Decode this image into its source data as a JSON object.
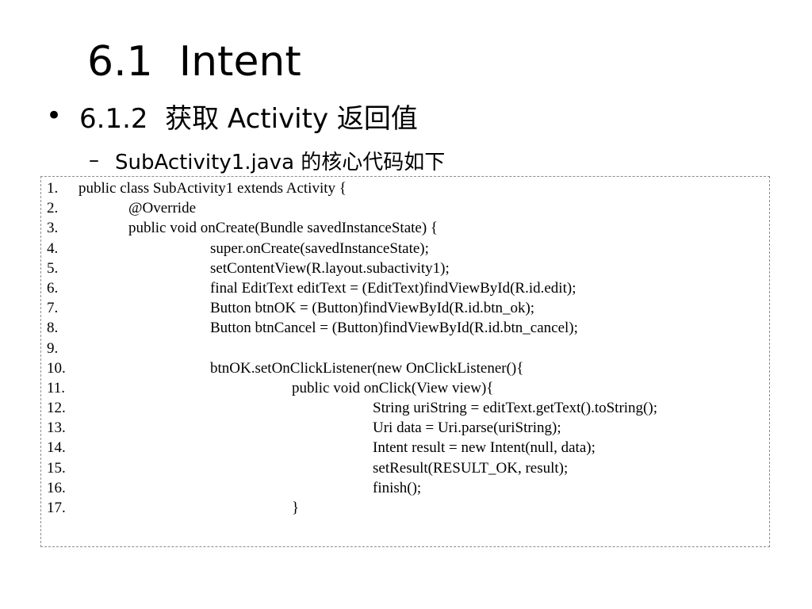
{
  "slide": {
    "title": "6.1  Intent",
    "bullet1": {
      "marker": "•",
      "text": "6.1.2  获取 Activity 返回值"
    },
    "bullet2": {
      "marker": "–",
      "text": "SubActivity1.java 的核心代码如下"
    }
  },
  "code": {
    "lines": [
      {
        "num": "1.",
        "text": "public class SubActivity1 extends Activity {"
      },
      {
        "num": "2.",
        "text": "@Override"
      },
      {
        "num": "3.",
        "text": "public void onCreate(Bundle savedInstanceState) {"
      },
      {
        "num": "4.",
        "text": "super.onCreate(savedInstanceState);"
      },
      {
        "num": "5.",
        "text": "setContentView(R.layout.subactivity1);"
      },
      {
        "num": "6.",
        "text": "final EditText editText = (EditText)findViewById(R.id.edit);"
      },
      {
        "num": "7.",
        "text": "Button btnOK = (Button)findViewById(R.id.btn_ok);"
      },
      {
        "num": "8.",
        "text": "Button btnCancel = (Button)findViewById(R.id.btn_cancel);"
      },
      {
        "num": "9.",
        "text": ""
      },
      {
        "num": "10.",
        "text": "btnOK.setOnClickListener(new OnClickListener(){"
      },
      {
        "num": "11.",
        "text": "public void onClick(View view){"
      },
      {
        "num": "12.",
        "text": "String uriString = editText.getText().toString();"
      },
      {
        "num": "13.",
        "text": "Uri data = Uri.parse(uriString);"
      },
      {
        "num": "14.",
        "text": "Intent result = new Intent(null, data);"
      },
      {
        "num": "15.",
        "text": "setResult(RESULT_OK, result);"
      },
      {
        "num": "16.",
        "text": "finish();"
      },
      {
        "num": "17.",
        "text": "}"
      }
    ]
  }
}
